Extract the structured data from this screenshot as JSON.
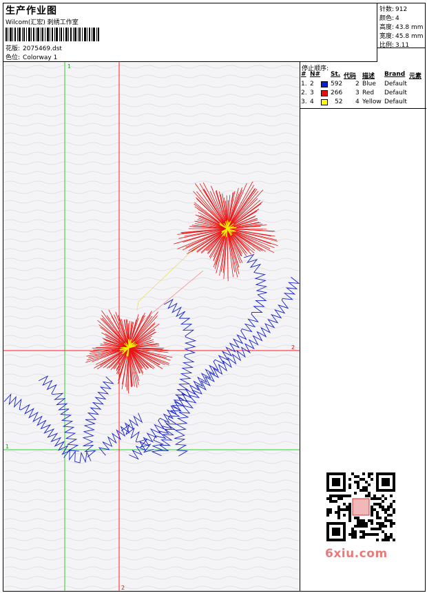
{
  "header": {
    "title": "生产作业图",
    "subtitle": "Wilcom(汇宏) 刺绣工作室",
    "design_label": "花版:",
    "design_value": "2075469.dst",
    "colorway_label": "色位:",
    "colorway_value": "Colorway 1"
  },
  "stats": {
    "stitches_label": "针数:",
    "stitches_value": "912",
    "colors_label": "颜色:",
    "colors_value": "4",
    "height_label": "高度:",
    "height_value": "43.8 mm",
    "width_label": "宽度:",
    "width_value": "45.8 mm",
    "scale_label": "比例:",
    "scale_value": "3.11"
  },
  "stop_sequence": {
    "heading": "停止顺序:",
    "columns": [
      "#",
      "N#",
      "St.",
      "代码",
      "描述",
      "Brand",
      "元素"
    ],
    "rows": [
      {
        "idx": "1.",
        "n": "2",
        "st": "592",
        "code": "2",
        "desc": "Blue",
        "brand": "Default",
        "color": "#0a1edc"
      },
      {
        "idx": "2.",
        "n": "3",
        "st": "266",
        "code": "3",
        "desc": "Red",
        "brand": "Default",
        "color": "#e8100c"
      },
      {
        "idx": "3.",
        "n": "4",
        "st": "52",
        "code": "4",
        "desc": "Yellow",
        "brand": "Default",
        "color": "#ffff00"
      }
    ]
  },
  "axes": {
    "green_vertical_label": "1",
    "green_horizontal_label": "1",
    "red_vertical_label": "2",
    "red_horizontal_label": "2"
  },
  "watermark": {
    "site": "6xiu.com"
  },
  "colors": {
    "blue_thread": "#1420d2",
    "red_thread": "#e81212",
    "yellow_thread": "#f5f000",
    "green_axis": "#28d228",
    "red_axis": "#ff1e1e"
  }
}
